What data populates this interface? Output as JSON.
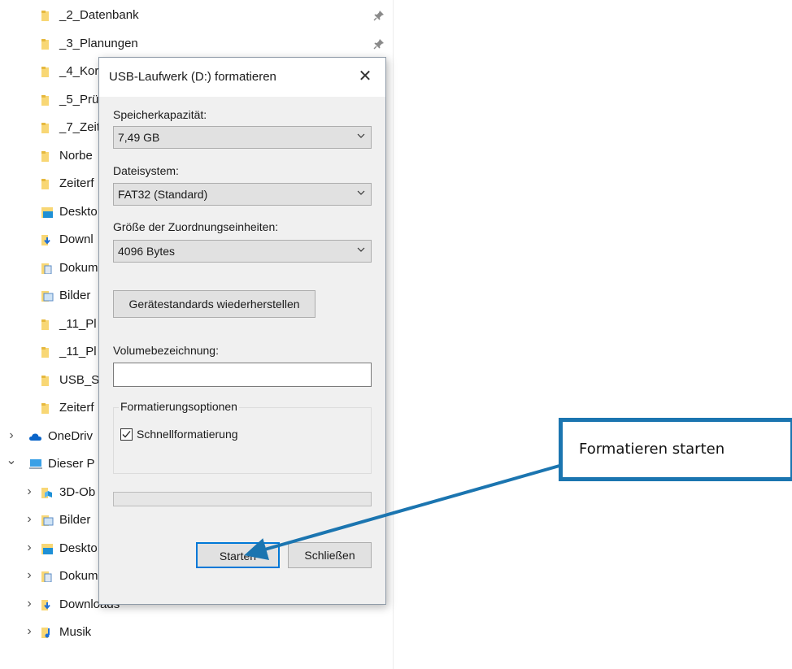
{
  "nav": {
    "items": [
      {
        "label": "_2_Datenbank",
        "icon": "folder-icon",
        "pinned": true
      },
      {
        "label": "_3_Planungen",
        "icon": "folder-icon",
        "pinned": true
      },
      {
        "label": "_4_Kor",
        "icon": "folder-icon",
        "pinned": true
      },
      {
        "label": "_5_Prü",
        "icon": "folder-icon",
        "pinned": true
      },
      {
        "label": "_7_Zeit",
        "icon": "folder-icon",
        "pinned": true
      },
      {
        "label": "Norbe",
        "icon": "folder-icon",
        "pinned": true
      },
      {
        "label": "Zeiterf",
        "icon": "folder-icon",
        "pinned": true
      },
      {
        "label": "Deskto",
        "icon": "desktop-folder-icon",
        "pinned": true
      },
      {
        "label": "Downl",
        "icon": "downloads-folder-icon",
        "pinned": true
      },
      {
        "label": "Dokum",
        "icon": "documents-folder-icon",
        "pinned": true
      },
      {
        "label": "Bilder",
        "icon": "pictures-folder-icon",
        "pinned": true
      },
      {
        "label": "_11_Pl",
        "icon": "folder-icon",
        "pinned": true
      },
      {
        "label": "_11_Pl",
        "icon": "folder-icon",
        "pinned": true
      },
      {
        "label": "USB_St",
        "icon": "folder-icon",
        "pinned": false
      },
      {
        "label": "Zeiterf",
        "icon": "folder-icon",
        "pinned": false
      },
      {
        "label": "OneDriv",
        "icon": "onedrive-icon",
        "chevron": "right"
      },
      {
        "label": "Dieser P",
        "icon": "this-pc-icon",
        "chevron": "down"
      },
      {
        "label": "3D-Ob",
        "icon": "3d-objects-icon",
        "chevron": "right",
        "indent": true
      },
      {
        "label": "Bilder",
        "icon": "pictures-folder-icon",
        "chevron": "right",
        "indent": true
      },
      {
        "label": "Deskto",
        "icon": "desktop-folder-icon",
        "chevron": "right",
        "indent": true
      },
      {
        "label": "Dokumente",
        "icon": "documents-folder-icon",
        "chevron": "right",
        "indent": true
      },
      {
        "label": "Downloads",
        "icon": "downloads-folder-icon",
        "chevron": "right",
        "indent": true
      },
      {
        "label": "Musik",
        "icon": "music-folder-icon",
        "chevron": "right",
        "indent": true
      }
    ]
  },
  "dialog": {
    "title": "USB-Laufwerk (D:) formatieren",
    "capacity": {
      "label": "Speicherkapazität:",
      "value": "7,49 GB"
    },
    "filesystem": {
      "label": "Dateisystem:",
      "value": "FAT32 (Standard)"
    },
    "allocation": {
      "label": "Größe der Zuordnungseinheiten:",
      "value": "4096 Bytes"
    },
    "restore_defaults_label": "Gerätestandards wiederherstellen",
    "volume": {
      "label": "Volumebezeichnung:",
      "value": ""
    },
    "options": {
      "group_label": "Formatierungsoptionen",
      "quick_format_label": "Schnellformatierung",
      "quick_format_checked": true
    },
    "progress": 0,
    "start_label": "Starten",
    "close_label": "Schließen"
  },
  "annotation": {
    "text": "Formatieren starten",
    "color": "#1b75b0"
  },
  "colors": {
    "folder_yellow": "#f8d775",
    "accent_blue": "#1b75b0",
    "focus_blue": "#0078d7"
  }
}
